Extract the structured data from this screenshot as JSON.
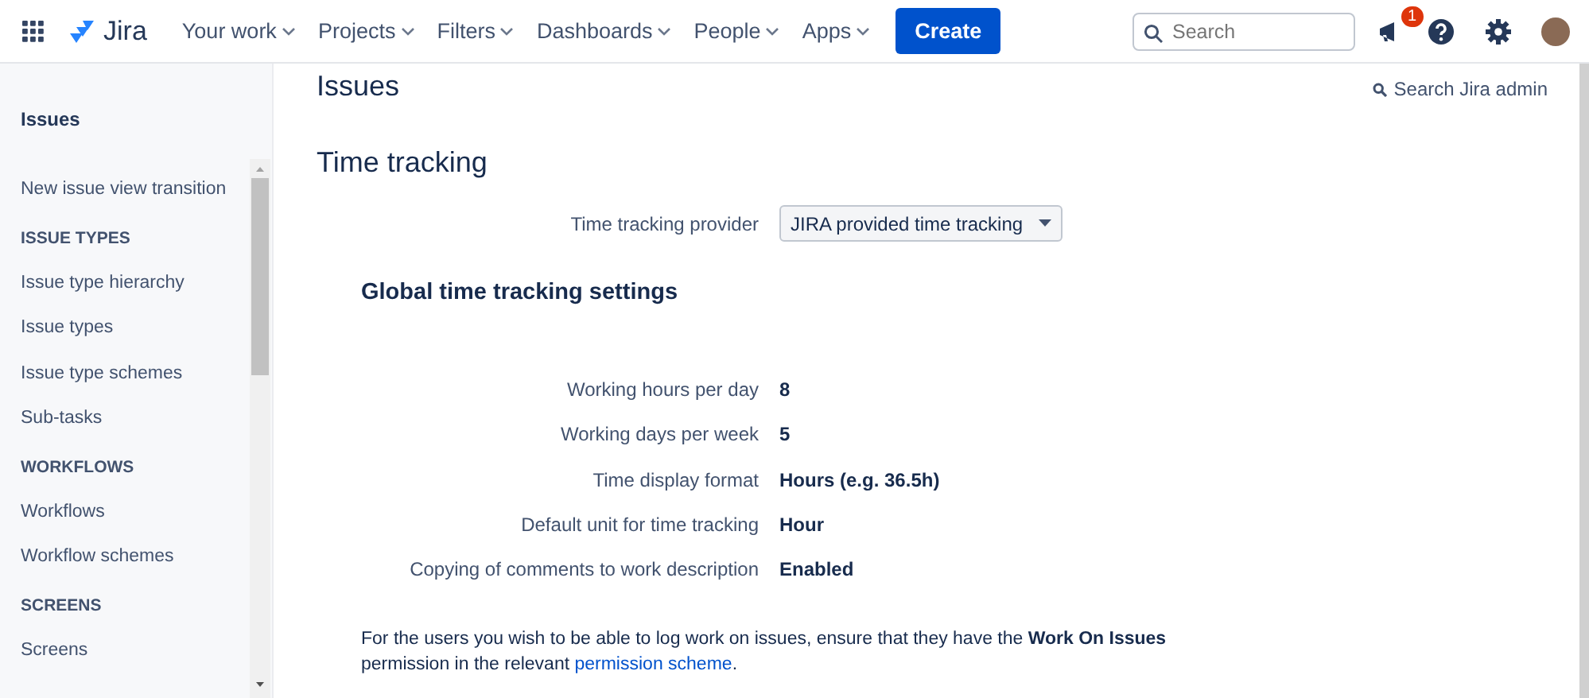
{
  "topbar": {
    "logo": "Jira",
    "nav": [
      {
        "label": "Your work"
      },
      {
        "label": "Projects"
      },
      {
        "label": "Filters"
      },
      {
        "label": "Dashboards"
      },
      {
        "label": "People"
      },
      {
        "label": "Apps"
      }
    ],
    "create_button": "Create",
    "search": {
      "placeholder": "Search"
    },
    "notifications_badge": "1"
  },
  "sidebar": {
    "title": "Issues",
    "items": [
      {
        "kind": "link",
        "label": "New issue view transition"
      },
      {
        "kind": "heading",
        "label": "ISSUE TYPES"
      },
      {
        "kind": "link",
        "label": "Issue type hierarchy"
      },
      {
        "kind": "link",
        "label": "Issue types"
      },
      {
        "kind": "link",
        "label": "Issue type schemes"
      },
      {
        "kind": "link",
        "label": "Sub-tasks"
      },
      {
        "kind": "heading",
        "label": "WORKFLOWS"
      },
      {
        "kind": "link",
        "label": "Workflows"
      },
      {
        "kind": "link",
        "label": "Workflow schemes"
      },
      {
        "kind": "heading",
        "label": "SCREENS"
      },
      {
        "kind": "link",
        "label": "Screens"
      }
    ]
  },
  "main": {
    "page_title": "Issues",
    "admin_search": "Search Jira admin",
    "section_title": "Time tracking",
    "provider": {
      "label": "Time tracking provider",
      "value": "JIRA provided time tracking"
    },
    "settings_title": "Global time tracking settings",
    "settings": [
      {
        "label": "Working hours per day",
        "value": "8"
      },
      {
        "label": "Working days per week",
        "value": "5"
      },
      {
        "label": "Time display format",
        "value": "Hours (e.g. 36.5h)"
      },
      {
        "label": "Default unit for time tracking",
        "value": "Hour"
      },
      {
        "label": "Copying of comments to work description",
        "value": "Enabled"
      }
    ],
    "note": {
      "text": "For the users you wish to be able to log work on issues, ensure that they have the **Work On Issues** permission in the relevant",
      "link": "permission scheme",
      "after": "."
    }
  }
}
